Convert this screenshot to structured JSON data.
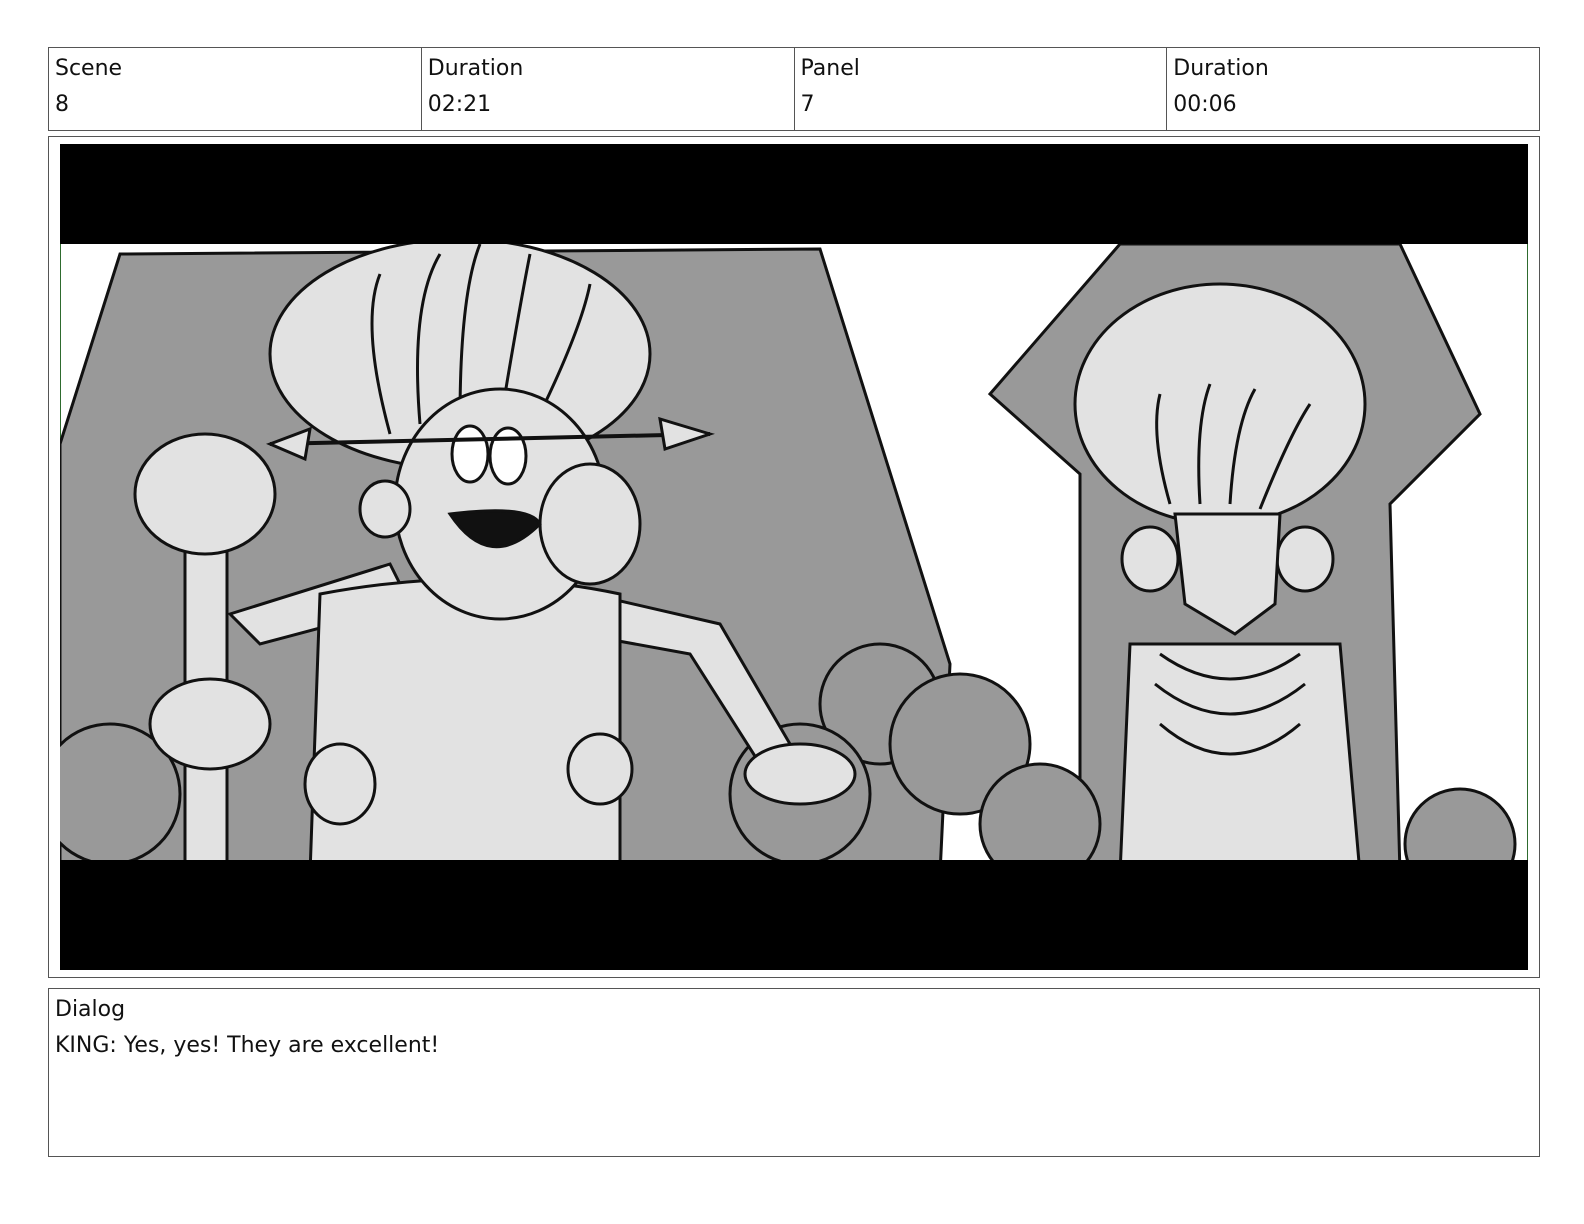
{
  "header": {
    "scene_label": "Scene",
    "scene_value": "8",
    "duration_label": "Duration",
    "duration_value": "02:21",
    "panel_label": "Panel",
    "panel_value": "7",
    "panel_duration_label": "Duration",
    "panel_duration_value": "00:06"
  },
  "dialog": {
    "label": "Dialog",
    "text": "KING: Yes, yes! They are excellent!"
  },
  "colors": {
    "frame_border": "#2e6b2e",
    "letterbox": "#000000",
    "throne_gray": "#999999",
    "figure_light": "#e2e2e2"
  }
}
